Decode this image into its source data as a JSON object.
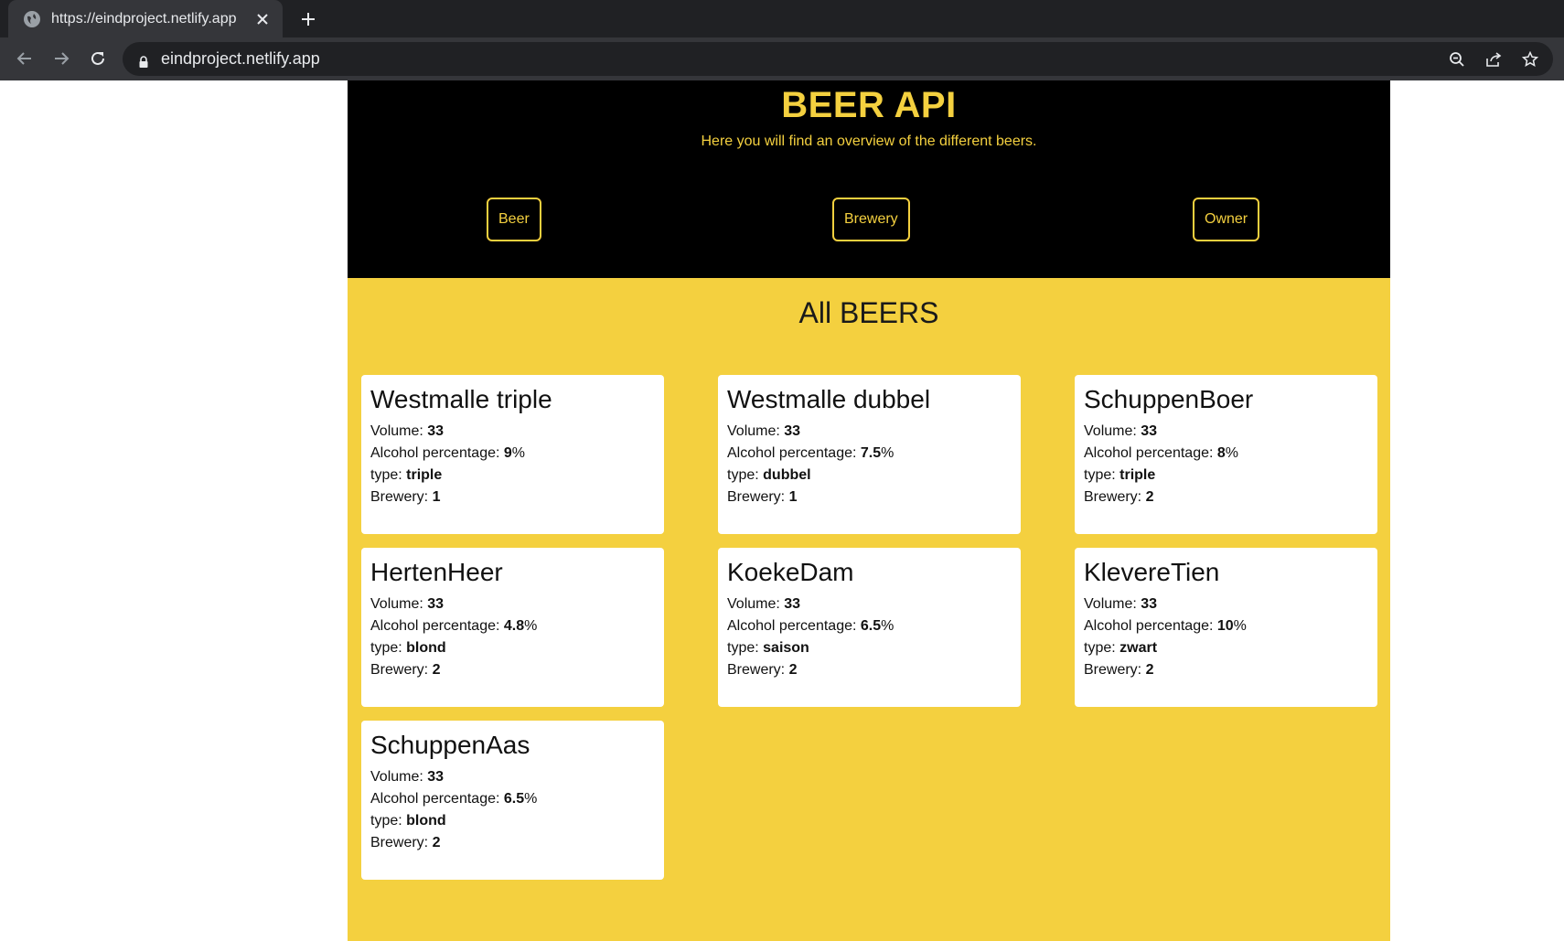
{
  "browser": {
    "tab_title": "https://eindproject.netlify.app",
    "url": "eindproject.netlify.app"
  },
  "header": {
    "title": "BEER API",
    "subtitle": "Here you will find an overview of the different beers.",
    "nav": [
      "Beer",
      "Brewery",
      "Owner"
    ]
  },
  "main": {
    "title": "All BEERS",
    "labels": {
      "volume": "Volume: ",
      "alcohol": "Alcohol percentage: ",
      "percent_sign": "%",
      "type": "type: ",
      "brewery": "Brewery: "
    },
    "beers": [
      {
        "name": "Westmalle triple",
        "volume": "33",
        "alcohol": "9",
        "type": "triple",
        "brewery": "1"
      },
      {
        "name": "Westmalle dubbel",
        "volume": "33",
        "alcohol": "7.5",
        "type": "dubbel",
        "brewery": "1"
      },
      {
        "name": "SchuppenBoer",
        "volume": "33",
        "alcohol": "8",
        "type": "triple",
        "brewery": "2"
      },
      {
        "name": "HertenHeer",
        "volume": "33",
        "alcohol": "4.8",
        "type": "blond",
        "brewery": "2"
      },
      {
        "name": "KoekeDam",
        "volume": "33",
        "alcohol": "6.5",
        "type": "saison",
        "brewery": "2"
      },
      {
        "name": "KlevereTien",
        "volume": "33",
        "alcohol": "10",
        "type": "zwart",
        "brewery": "2"
      },
      {
        "name": "SchuppenAas",
        "volume": "33",
        "alcohol": "6.5",
        "type": "blond",
        "brewery": "2"
      }
    ]
  },
  "colors": {
    "accent": "#f4d03f",
    "header_bg": "#000000",
    "card_bg": "#ffffff"
  },
  "icons": {
    "tab_favicon": "globe-icon",
    "tab_close": "close-icon",
    "new_tab": "plus-icon",
    "back": "arrow-left-icon",
    "forward": "arrow-right-icon",
    "reload": "reload-icon",
    "lock": "lock-icon",
    "zoom": "zoom-out-icon",
    "share": "share-icon",
    "bookmark": "star-icon"
  }
}
